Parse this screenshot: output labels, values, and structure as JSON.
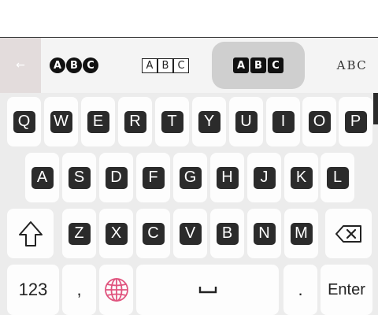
{
  "style_bar": {
    "back_icon": "left-arrow-icon",
    "back_label": "←",
    "options": [
      {
        "name": "circled",
        "letters": [
          "A",
          "B",
          "C"
        ]
      },
      {
        "name": "boxed",
        "letters": [
          "A",
          "B",
          "C"
        ]
      },
      {
        "name": "squared",
        "letters": [
          "A",
          "B",
          "C"
        ]
      },
      {
        "name": "fraktur",
        "letters": [
          "A",
          "B",
          "C"
        ]
      }
    ],
    "selected_index": 2
  },
  "keyboard": {
    "row1": [
      "Q",
      "W",
      "E",
      "R",
      "T",
      "Y",
      "U",
      "I",
      "O",
      "P"
    ],
    "row2": [
      "A",
      "S",
      "D",
      "F",
      "G",
      "H",
      "J",
      "K",
      "L"
    ],
    "row3": [
      "Z",
      "X",
      "C",
      "V",
      "B",
      "N",
      "M"
    ],
    "shift_icon": "shift-arrow-icon",
    "backspace_icon": "backspace-icon",
    "numbers_label": "123",
    "comma_label": ",",
    "globe_icon": "globe-icon",
    "space_label": "␣",
    "period_label": ".",
    "enter_label": "Enter",
    "accent_color": "#e0557f"
  }
}
